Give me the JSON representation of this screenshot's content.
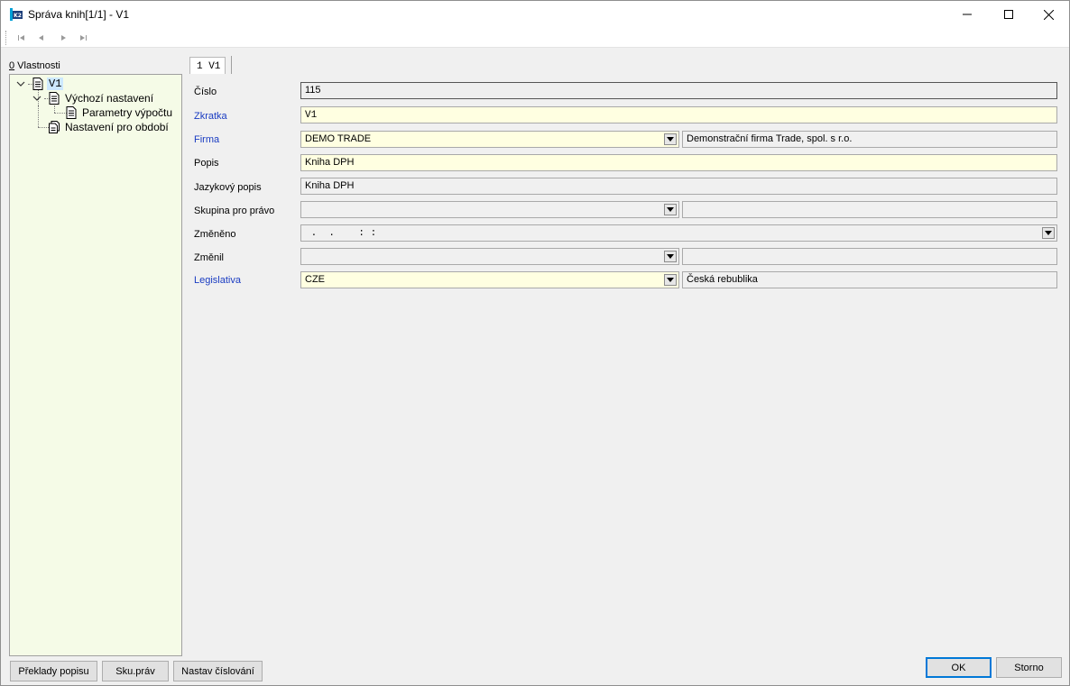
{
  "window": {
    "title": "Správa knih[1/1] - V1"
  },
  "properties": {
    "hotkey": "0",
    "label_rest": " Vlastnosti"
  },
  "tree": [
    {
      "label": "V1"
    },
    {
      "label": "Výchozí nastavení"
    },
    {
      "label": "Parametry výpočtu"
    },
    {
      "label": "Nastavení pro období"
    }
  ],
  "tab": {
    "label": "1 V1"
  },
  "form": {
    "cislo": {
      "label": "Číslo",
      "value": "115"
    },
    "zkratka": {
      "label": "Zkratka",
      "value": "V1"
    },
    "firma": {
      "label": "Firma",
      "value": "DEMO TRADE",
      "description": "Demonstrační firma Trade, spol. s r.o."
    },
    "popis": {
      "label": "Popis",
      "value": "Kniha DPH"
    },
    "jazykovy_popis": {
      "label": "Jazykový popis",
      "value": "Kniha DPH"
    },
    "skupina": {
      "label": "Skupina pro právo",
      "value": "",
      "description": ""
    },
    "zmeneno": {
      "label": "Změněno",
      "value": " .  .    : :"
    },
    "zmenil": {
      "label": "Změnil",
      "value": "",
      "description": ""
    },
    "legislativa": {
      "label": "Legislativa",
      "value": "CZE",
      "description": "Česká rebublika"
    }
  },
  "buttons": {
    "preklady": "Překlady popisu",
    "sku_prav": "Sku.práv",
    "nastav_cislovani": "Nastav číslování",
    "ok": "OK",
    "storno": "Storno"
  },
  "colors": {
    "required_label": "#1a3cc2",
    "tree_background": "#f5fbe7",
    "editable_field": "#ffffe1",
    "selection": "#cde8ff"
  }
}
